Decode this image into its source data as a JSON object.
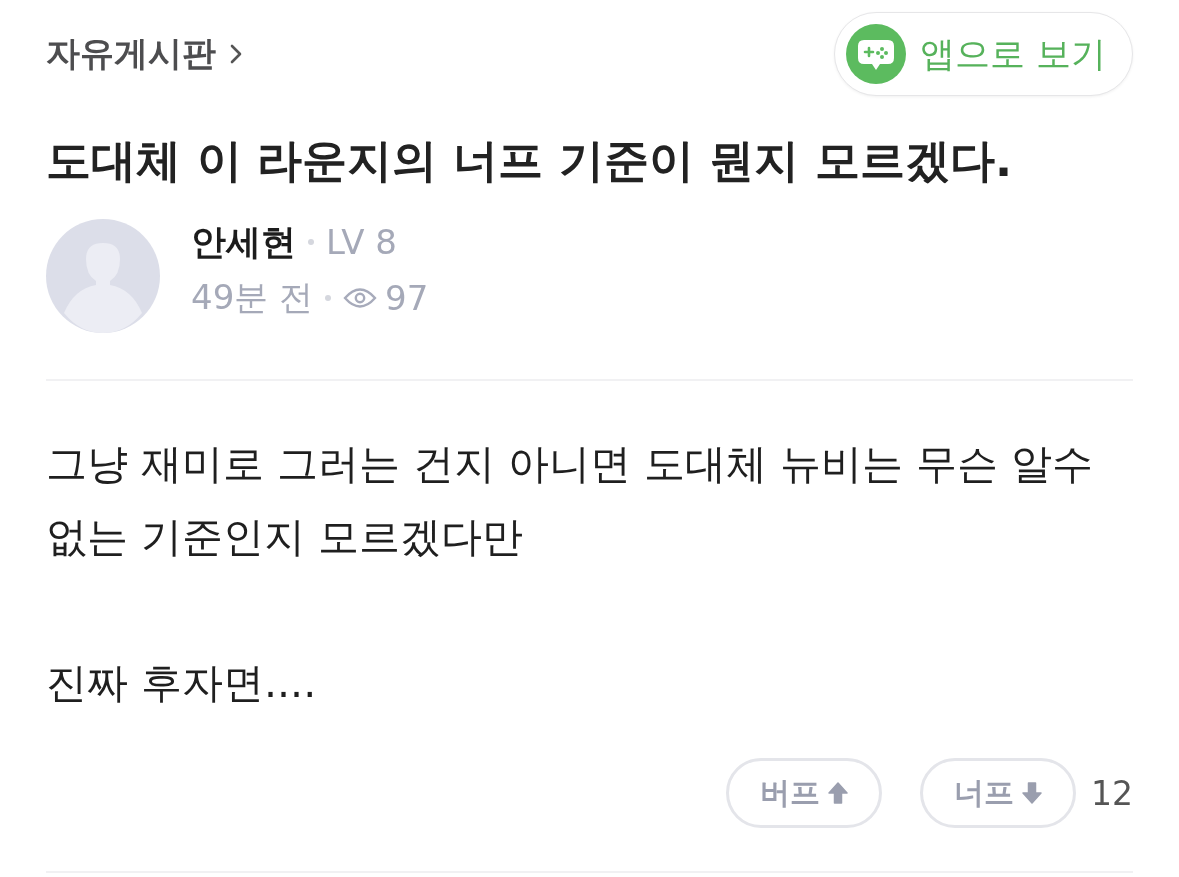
{
  "breadcrumb": {
    "label": "자유게시판"
  },
  "app_button": {
    "label": "앱으로 보기"
  },
  "post": {
    "title": "도대체 이 라운지의 너프 기준이 뭔지 모르겠다.",
    "author": {
      "name": "안세현",
      "level": "LV 8"
    },
    "time": "49분 전",
    "views": "97",
    "paragraphs": [
      "그냥 재미로 그러는 건지 아니면 도대체 뉴비는 무슨 알수 없는 기준인지 모르겠다만",
      "진짜 후자면...."
    ]
  },
  "votes": {
    "buttons": [
      {
        "kind": "buff",
        "label": "버프"
      },
      {
        "kind": "nerf",
        "label": "너프"
      }
    ],
    "count": "12"
  }
}
